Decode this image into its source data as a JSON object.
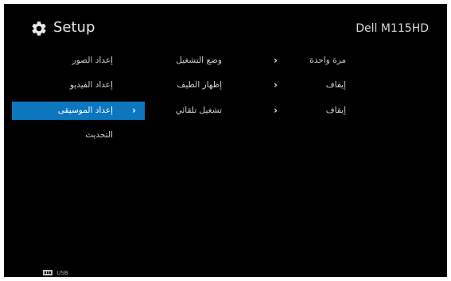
{
  "header": {
    "title": "Setup",
    "model": "Dell M115HD",
    "icon": "gear-icon"
  },
  "categories": [
    {
      "label": "إعداد الصور",
      "selected": false
    },
    {
      "label": "إعداد الفيديو",
      "selected": false
    },
    {
      "label": "إعداد الموسيقى",
      "selected": true
    },
    {
      "label": "التحديث",
      "selected": false
    }
  ],
  "settings": [
    {
      "name": "وضع التشغيل",
      "value": "مرة واحدة"
    },
    {
      "name": "إظهار الطيف",
      "value": "إيقاف"
    },
    {
      "name": "تشغيل تلقائي",
      "value": "إيقاف"
    }
  ],
  "footer": {
    "source_label": "USB",
    "source_icon": "usb-icon"
  },
  "colors": {
    "background": "#000000",
    "selection": "#0c76bf",
    "text": "#cfcfcf"
  }
}
